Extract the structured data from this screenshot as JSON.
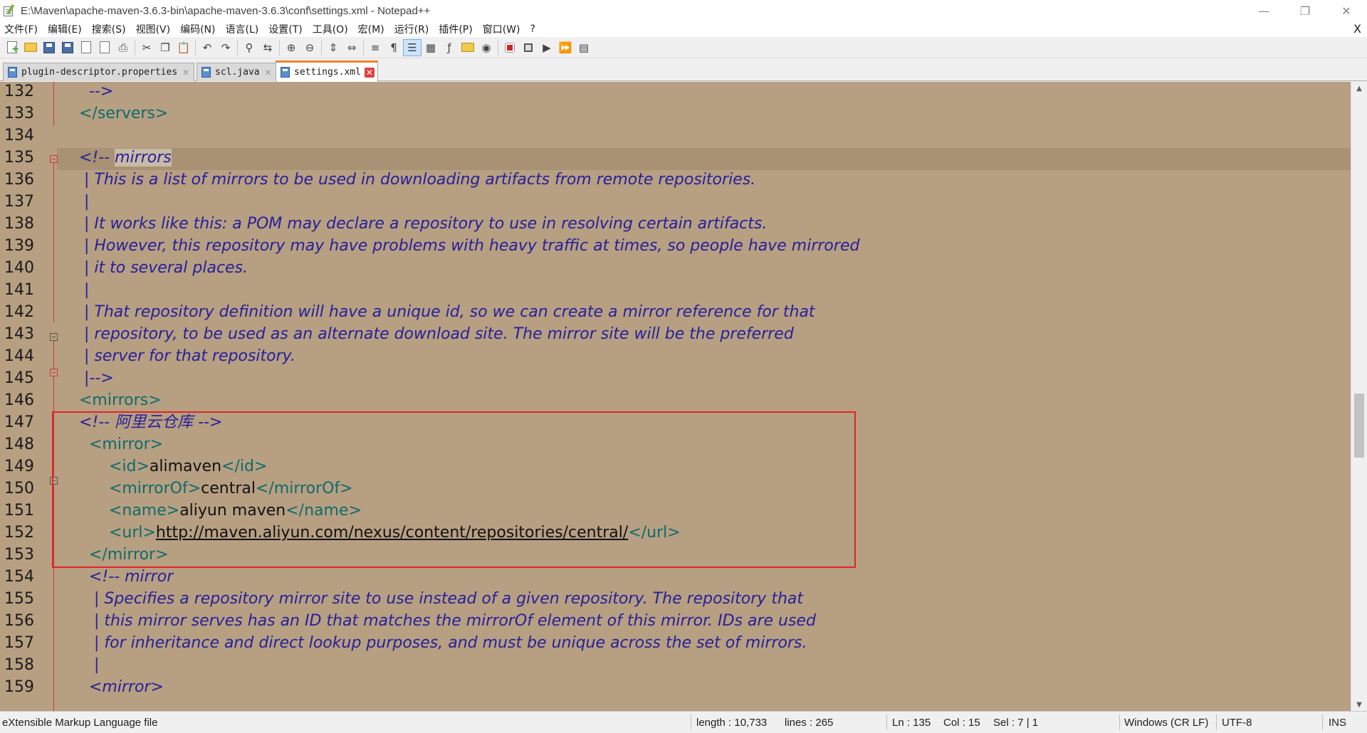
{
  "window": {
    "title": "E:\\Maven\\apache-maven-3.6.3-bin\\apache-maven-3.6.3\\conf\\settings.xml - Notepad++",
    "minimize": "—",
    "restore": "❐",
    "close": "✕"
  },
  "menu": {
    "items": [
      "文件(F)",
      "编辑(E)",
      "搜索(S)",
      "视图(V)",
      "编码(N)",
      "语言(L)",
      "设置(T)",
      "工具(O)",
      "宏(M)",
      "运行(R)",
      "插件(P)",
      "窗口(W)",
      "?"
    ],
    "close": "X"
  },
  "toolbar": {
    "icons": [
      "new-file-icon",
      "open-folder-icon",
      "save-icon",
      "save-all-icon",
      "close-icon",
      "close-all-icon",
      "print-icon",
      "cut-icon",
      "copy-icon",
      "paste-icon",
      "undo-icon",
      "redo-icon",
      "find-icon",
      "replace-icon",
      "zoom-in-icon",
      "zoom-out-icon",
      "sync-vertical-icon",
      "sync-horizontal-icon",
      "word-wrap-icon",
      "show-all-chars-icon",
      "indent-guide-icon",
      "doc-map-icon",
      "function-list-icon",
      "folder-workspace-icon",
      "monitoring-icon",
      "record-macro-icon",
      "stop-record-icon",
      "play-macro-icon",
      "run-multiple-icon",
      "save-macro-icon"
    ]
  },
  "tabs": [
    {
      "label": "plugin-descriptor.properties",
      "active": false
    },
    {
      "label": "scl.java",
      "active": false
    },
    {
      "label": "settings.xml",
      "active": true
    }
  ],
  "editor": {
    "lines": [
      {
        "n": "132",
        "segs": [
          {
            "t": "    -->",
            "c": "c-comment"
          }
        ]
      },
      {
        "n": "133",
        "segs": [
          {
            "t": "  </servers>",
            "c": "c-tag"
          }
        ]
      },
      {
        "n": "134",
        "segs": []
      },
      {
        "n": "135",
        "segs": [
          {
            "t": "  <!-- ",
            "c": "c-comment"
          },
          {
            "t": "mirrors",
            "c": "c-comment sel"
          }
        ]
      },
      {
        "n": "136",
        "segs": [
          {
            "t": "   | This is a list of mirrors to be used in downloading artifacts from remote repositories.",
            "c": "c-comment"
          }
        ]
      },
      {
        "n": "137",
        "segs": [
          {
            "t": "   |",
            "c": "c-comment"
          }
        ]
      },
      {
        "n": "138",
        "segs": [
          {
            "t": "   | It works like this: a POM may declare a repository to use in resolving certain artifacts.",
            "c": "c-comment"
          }
        ]
      },
      {
        "n": "139",
        "segs": [
          {
            "t": "   | However, this repository may have problems with heavy traffic at times, so people have mirrored",
            "c": "c-comment"
          }
        ]
      },
      {
        "n": "140",
        "segs": [
          {
            "t": "   | it to several places.",
            "c": "c-comment"
          }
        ]
      },
      {
        "n": "141",
        "segs": [
          {
            "t": "   |",
            "c": "c-comment"
          }
        ]
      },
      {
        "n": "142",
        "segs": [
          {
            "t": "   | That repository definition will have a unique id, so we can create a mirror reference for that",
            "c": "c-comment"
          }
        ]
      },
      {
        "n": "143",
        "segs": [
          {
            "t": "   | repository, to be used as an alternate download site. The mirror site will be the preferred",
            "c": "c-comment"
          }
        ]
      },
      {
        "n": "144",
        "segs": [
          {
            "t": "   | server for that repository.",
            "c": "c-comment"
          }
        ]
      },
      {
        "n": "145",
        "segs": [
          {
            "t": "   |-->",
            "c": "c-comment"
          }
        ]
      },
      {
        "n": "146",
        "segs": [
          {
            "t": "  <mirrors>",
            "c": "c-tag"
          }
        ]
      },
      {
        "n": "147",
        "segs": [
          {
            "t": "  <!-- 阿里云仓库 -->",
            "c": "c-comment"
          }
        ]
      },
      {
        "n": "148",
        "segs": [
          {
            "t": "    <mirror>",
            "c": "c-tag"
          }
        ]
      },
      {
        "n": "149",
        "segs": [
          {
            "t": "        <id>",
            "c": "c-tag"
          },
          {
            "t": "alimaven",
            "c": "c-text"
          },
          {
            "t": "</id>",
            "c": "c-tag"
          }
        ]
      },
      {
        "n": "150",
        "segs": [
          {
            "t": "        <mirrorOf>",
            "c": "c-tag"
          },
          {
            "t": "central",
            "c": "c-text"
          },
          {
            "t": "</mirrorOf>",
            "c": "c-tag"
          }
        ]
      },
      {
        "n": "151",
        "segs": [
          {
            "t": "        <name>",
            "c": "c-tag"
          },
          {
            "t": "aliyun maven",
            "c": "c-text"
          },
          {
            "t": "</name>",
            "c": "c-tag"
          }
        ]
      },
      {
        "n": "152",
        "segs": [
          {
            "t": "        <url>",
            "c": "c-tag"
          },
          {
            "t": "http://maven.aliyun.com/nexus/content/repositories/central/",
            "c": "c-url"
          },
          {
            "t": "</url>",
            "c": "c-tag"
          }
        ]
      },
      {
        "n": "153",
        "segs": [
          {
            "t": "    </mirror>",
            "c": "c-tag"
          }
        ]
      },
      {
        "n": "154",
        "segs": [
          {
            "t": "    <!-- mirror",
            "c": "c-comment"
          }
        ]
      },
      {
        "n": "155",
        "segs": [
          {
            "t": "     | Specifies a repository mirror site to use instead of a given repository. The repository that",
            "c": "c-comment"
          }
        ]
      },
      {
        "n": "156",
        "segs": [
          {
            "t": "     | this mirror serves has an ID that matches the mirrorOf element of this mirror. IDs are used",
            "c": "c-comment"
          }
        ]
      },
      {
        "n": "157",
        "segs": [
          {
            "t": "     | for inheritance and direct lookup purposes, and must be unique across the set of mirrors.",
            "c": "c-comment"
          }
        ]
      },
      {
        "n": "158",
        "segs": [
          {
            "t": "     |",
            "c": "c-comment"
          }
        ]
      },
      {
        "n": "159",
        "segs": [
          {
            "t": "    <mirror>",
            "c": "c-comment"
          }
        ]
      }
    ]
  },
  "scrollbar": {
    "up": "▲",
    "down": "▼"
  },
  "status": {
    "file_type": "eXtensible Markup Language file",
    "length": "length : 10,733",
    "lines": "lines : 265",
    "ln": "Ln : 135",
    "col": "Col : 15",
    "sel": "Sel : 7 | 1",
    "eol": "Windows (CR LF)",
    "encoding": "UTF-8",
    "mode": "INS"
  }
}
